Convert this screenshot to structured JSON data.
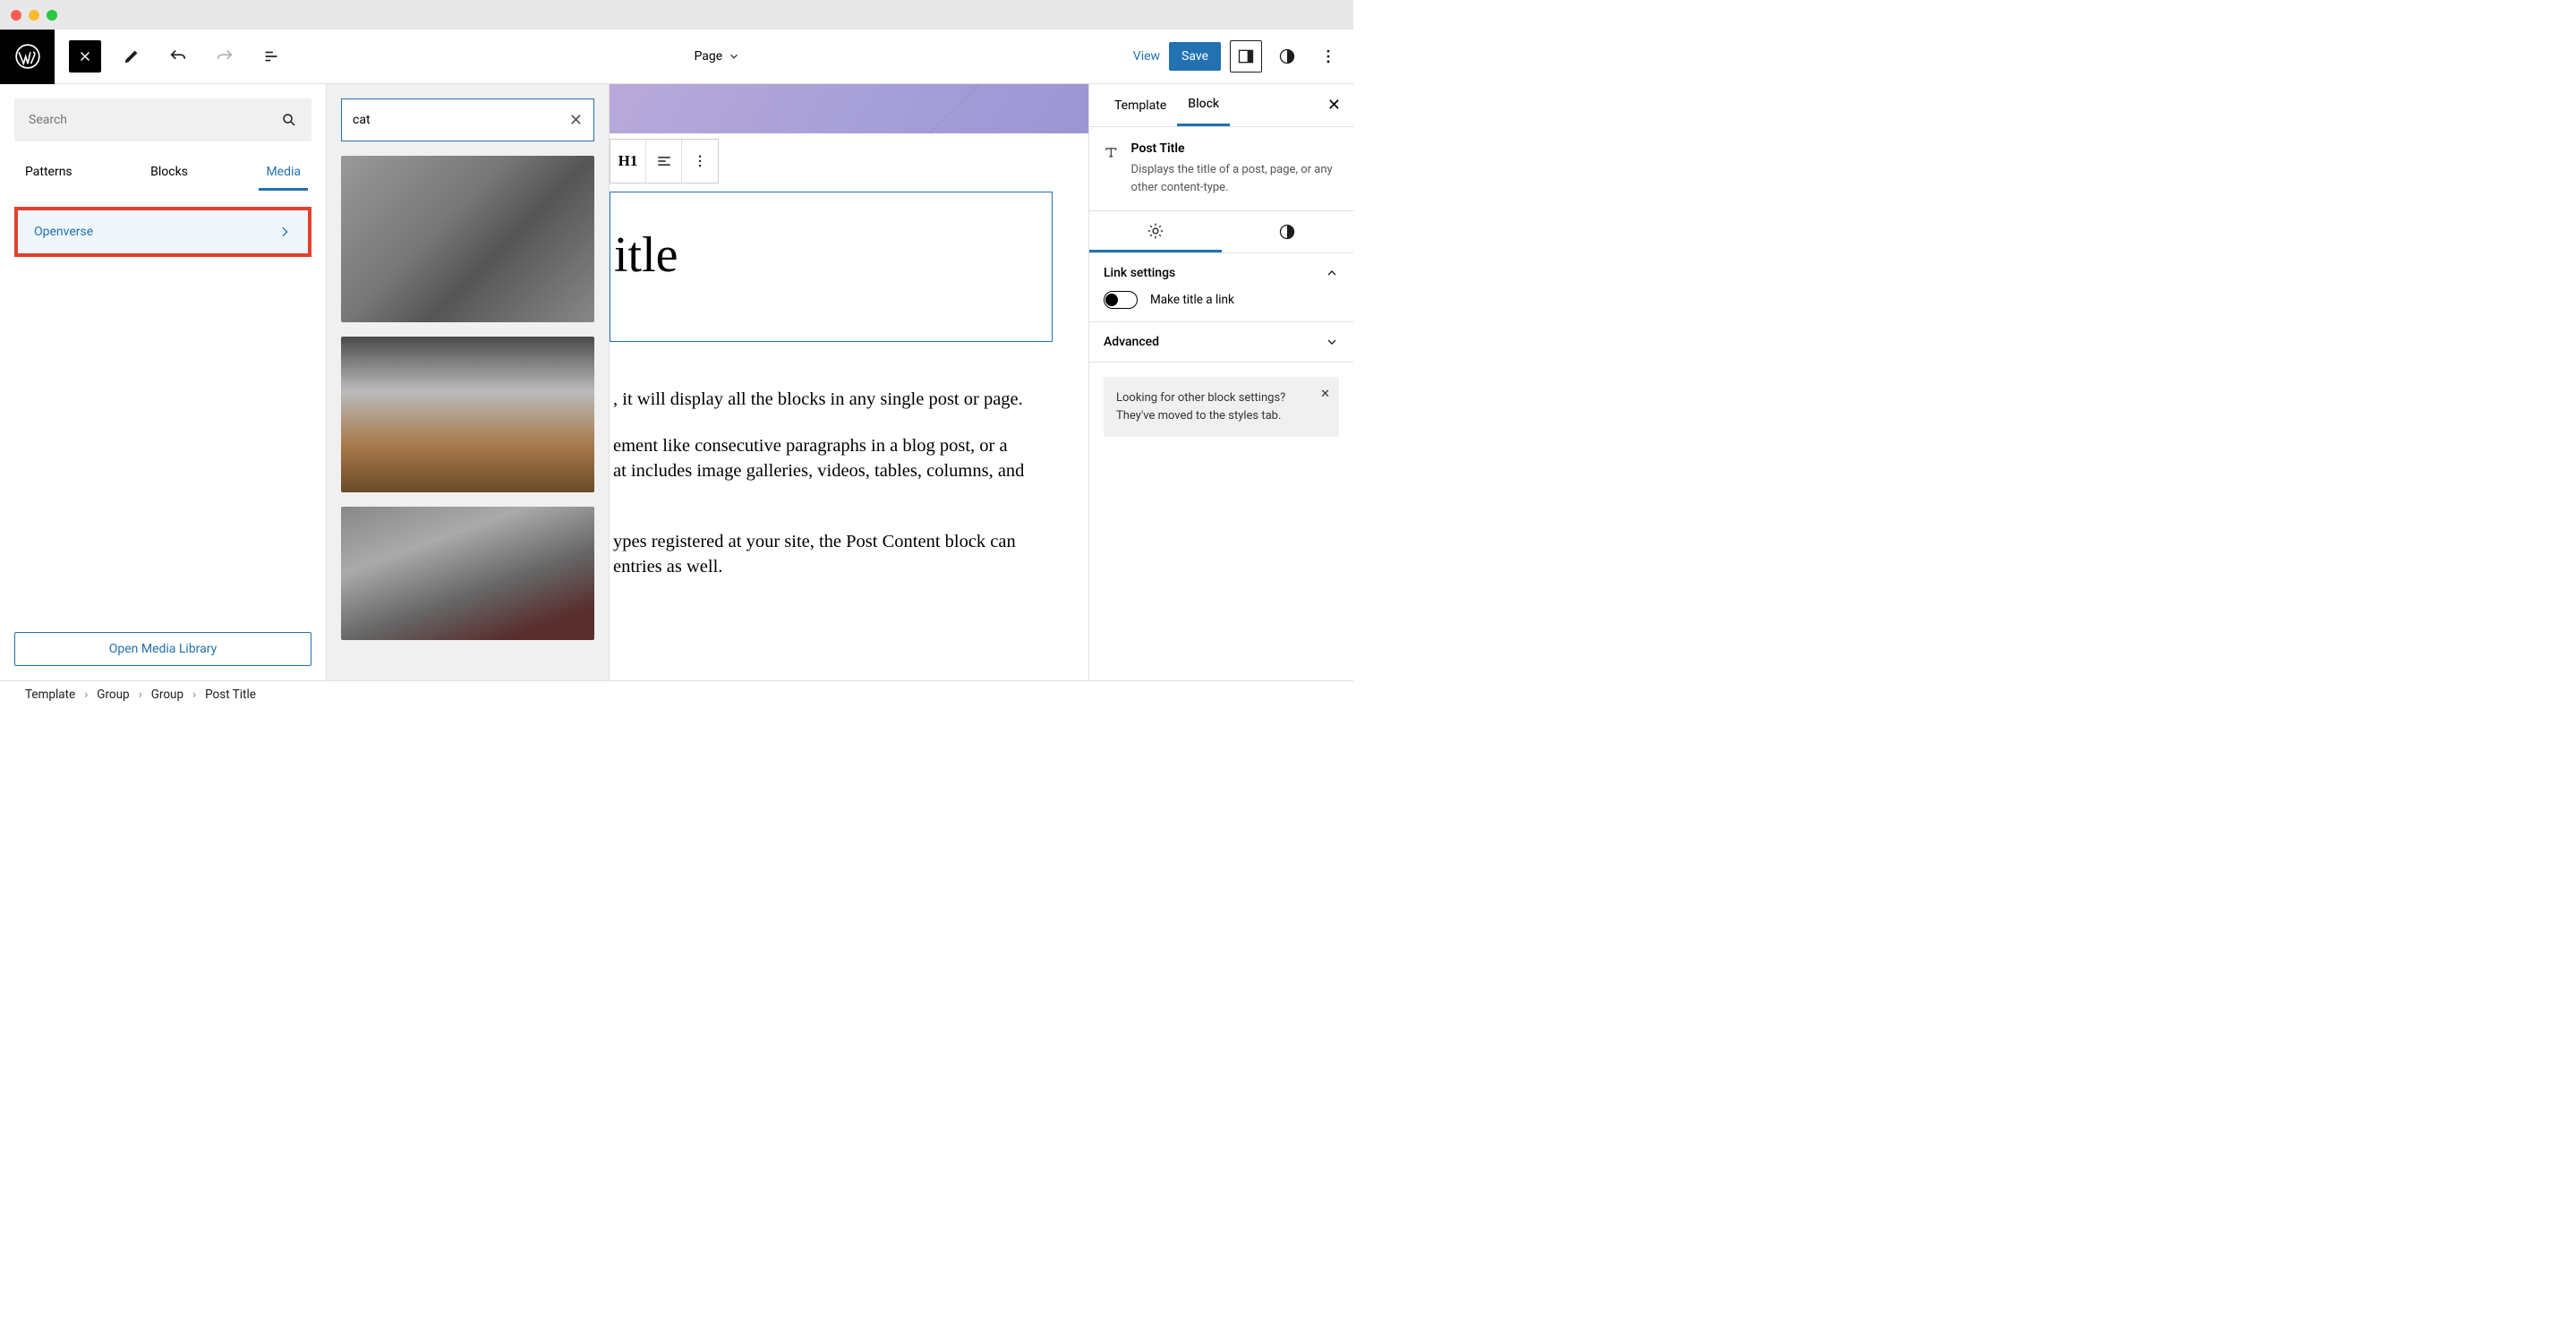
{
  "toolbar": {
    "doc_label": "Page",
    "view": "View",
    "save": "Save"
  },
  "left": {
    "search_placeholder": "Search",
    "tabs": [
      "Patterns",
      "Blocks",
      "Media"
    ],
    "openverse": "Openverse",
    "open_media": "Open Media Library"
  },
  "media": {
    "query": "cat"
  },
  "canvas": {
    "title": "itle",
    "p1": ", it will display all the blocks in any single post or page.",
    "p2a": "ement like consecutive paragraphs in a blog post, or a",
    "p2b": "at includes image galleries, videos, tables, columns, and",
    "p3a": "ypes registered at your site, the Post Content block can",
    "p3b": "entries as well."
  },
  "right": {
    "tabs": [
      "Template",
      "Block"
    ],
    "block_title": "Post Title",
    "block_desc": "Displays the title of a post, page, or any other content-type.",
    "link_settings": "Link settings",
    "make_link": "Make title a link",
    "advanced": "Advanced",
    "notice": "Looking for other block settings? They've moved to the styles tab."
  },
  "breadcrumbs": [
    "Template",
    "Group",
    "Group",
    "Post Title"
  ]
}
